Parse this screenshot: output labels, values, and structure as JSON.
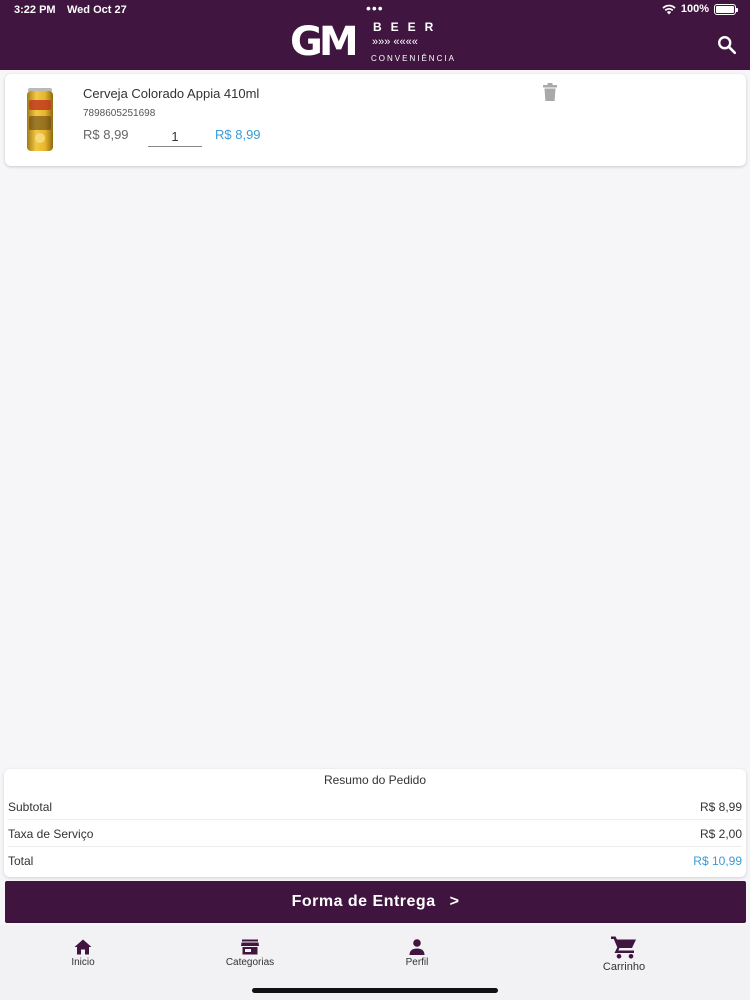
{
  "status_bar": {
    "time": "3:22 PM",
    "date": "Wed Oct 27",
    "battery": "100%"
  },
  "header": {
    "logo_mark": "GM",
    "logo_word": "BEER",
    "logo_arrows": "»»» ««««",
    "logo_sub": "CONVENIÊNCIA",
    "search_icon": "search-icon"
  },
  "cart": {
    "items": [
      {
        "name": "Cerveja Colorado Appia 410ml",
        "code": "7898605251698",
        "unit_price": "R$ 8,99",
        "quantity": "1",
        "total": "R$ 8,99",
        "delete_icon": "trash-icon"
      }
    ]
  },
  "summary": {
    "title": "Resumo do Pedido",
    "rows": [
      {
        "label": "Subtotal",
        "value": "R$ 8,99"
      },
      {
        "label": "Taxa de Serviço",
        "value": "R$ 2,00"
      },
      {
        "label": "Total",
        "value": "R$ 10,99"
      }
    ]
  },
  "delivery_button": {
    "label": "Forma de Entrega",
    "chevron": ">"
  },
  "bottom_nav": {
    "items": [
      {
        "label": "Inicio",
        "icon": "home-icon"
      },
      {
        "label": "Categorias",
        "icon": "store-icon"
      },
      {
        "label": "Perfil",
        "icon": "person-icon"
      },
      {
        "label": "Carrinho",
        "icon": "cart-icon",
        "active": true
      }
    ]
  },
  "colors": {
    "brand": "#401641",
    "accent_price": "#3a9bd5",
    "background": "#f6f5f8"
  }
}
